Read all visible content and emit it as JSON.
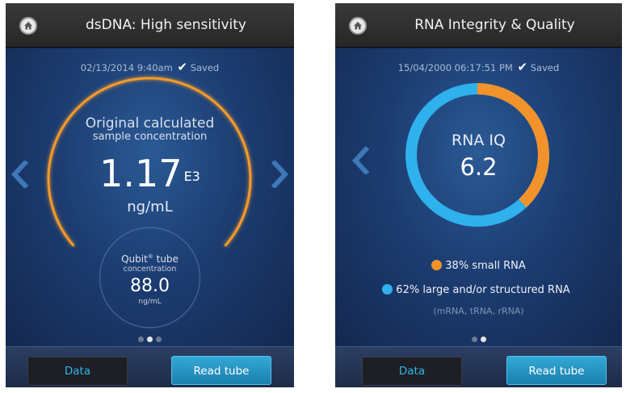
{
  "left_screen": {
    "title": "dsDNA: High sensitivity",
    "timestamp": "02/13/2014 9:40am",
    "saved_label": "Saved",
    "original_label": "Original calculated",
    "original_sublabel": "sample concentration",
    "original_value": "1.17",
    "original_exponent": "E3",
    "original_unit": "ng/mL",
    "tube_label": "Qubit",
    "tube_label_mark": "®",
    "tube_label_suffix": " tube",
    "tube_sublabel": "concentration",
    "tube_value": "88.0",
    "tube_unit": "ng/mL",
    "page_dots": 3,
    "active_dot": 2,
    "data_button": "Data",
    "read_button": "Read tube"
  },
  "right_screen": {
    "title": "RNA Integrity & Quality",
    "timestamp": "15/04/2000 06:17:51 PM",
    "saved_label": "Saved",
    "iq_label": "RNA IQ",
    "iq_value": "6.2",
    "legend_small": "38% small RNA",
    "legend_large": "62% large and/or structured RNA",
    "legend_note": "(mRNA, tRNA, rRNA)",
    "small_fraction": 0.38,
    "large_fraction": 0.62,
    "page_dots": 2,
    "active_dot": 2,
    "data_button": "Data",
    "read_button": "Read tube"
  },
  "colors": {
    "gauge_orange": "#f39a2c",
    "ring_blue": "#2fb1ee",
    "ring_orange": "#f2922a",
    "accent_blue": "#33b5e8",
    "arrow_blue": "#3d78b8"
  },
  "icons": {
    "home": "home-icon",
    "check": "checkmark-icon",
    "prev": "chevron-left-icon",
    "next": "chevron-right-icon"
  }
}
